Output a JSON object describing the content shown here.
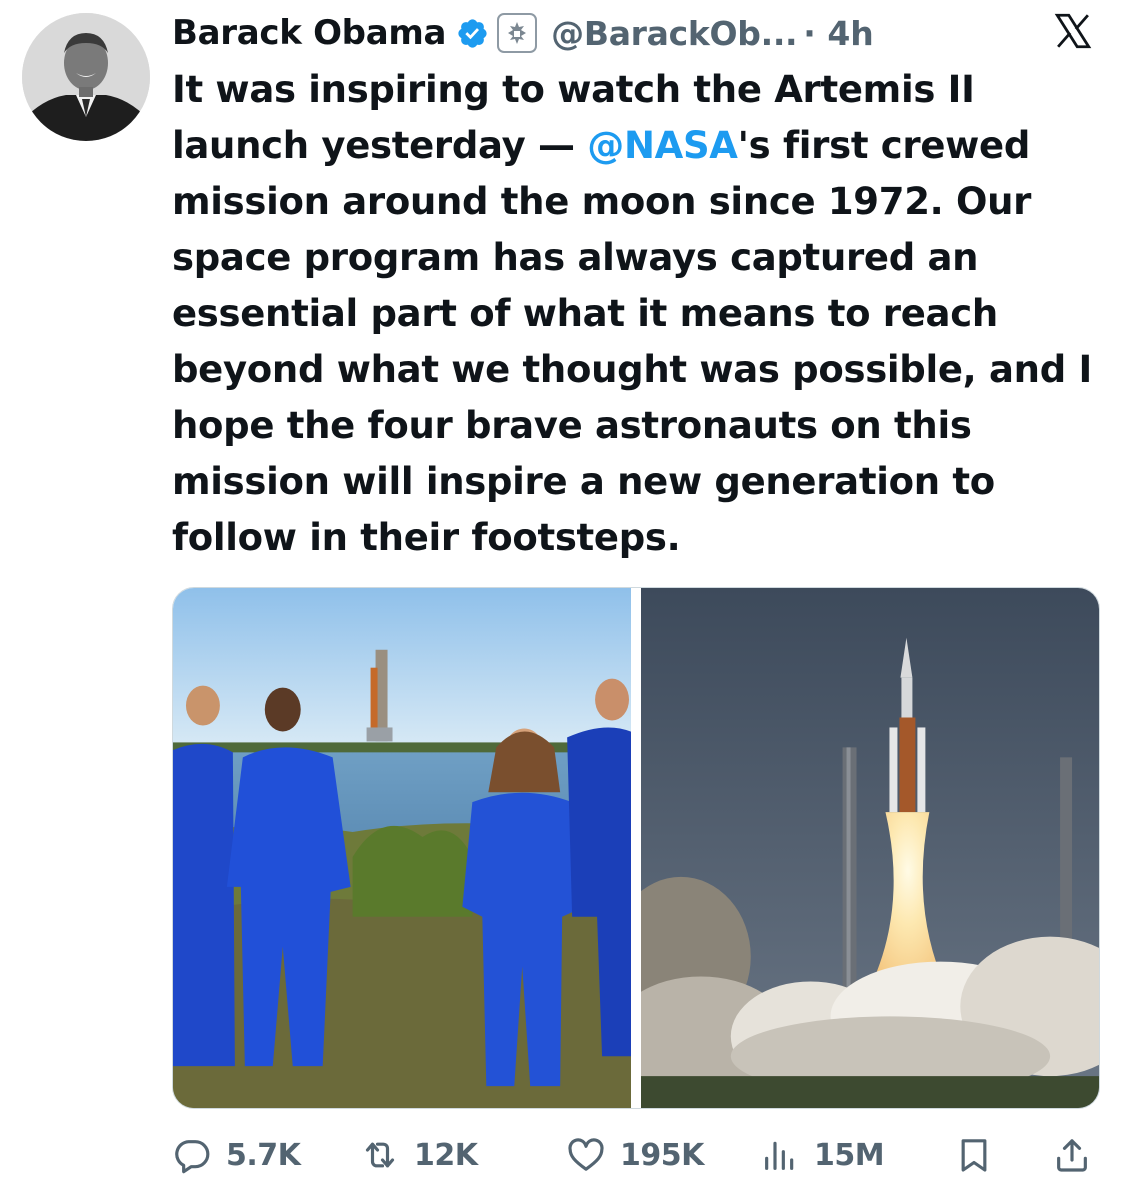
{
  "author": {
    "name": "Barack Obama",
    "handle": "@BarackOb...",
    "time": "· 4h",
    "verified_icon": "verified-badge-icon",
    "affiliation_icon": "government-seal-icon"
  },
  "platform_icon": "x-logo-icon",
  "tweet": {
    "lines": [
      "It was inspiring to watch the Artemis II",
      "launch yesterday — ",
      "'s first crewed",
      "mission around the moon since 1972. Our",
      "space program has always captured an",
      "essential part of what it means to reach",
      "beyond what we thought was possible, and I",
      "hope the four brave astronauts on this",
      "mission will inspire a new generation to",
      "follow in their footsteps."
    ],
    "mention": "@NASA"
  },
  "media": [
    {
      "icon": "astronauts-photo"
    },
    {
      "icon": "rocket-launch-photo"
    }
  ],
  "actions": {
    "replies": "5.7K",
    "reposts": "12K",
    "likes": "195K",
    "views": "15M"
  },
  "colors": {
    "accent": "#1d9bf0",
    "text": "#0f1419",
    "secondary": "#536471"
  }
}
